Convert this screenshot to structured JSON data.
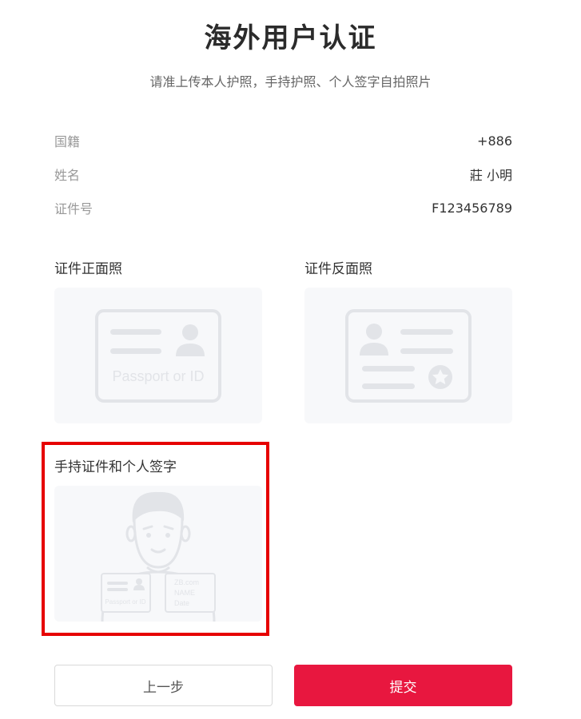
{
  "header": {
    "title": "海外用户认证",
    "subtitle": "请准上传本人护照，手持护照、个人签字自拍照片"
  },
  "info": [
    {
      "label": "国籍",
      "value": "+886"
    },
    {
      "label": "姓名",
      "value": "莊 小明"
    },
    {
      "label": "证件号",
      "value": "F123456789"
    }
  ],
  "uploads": {
    "front": {
      "label": "证件正面照",
      "illustration_text": "Passport or ID"
    },
    "back": {
      "label": "证件反面照"
    },
    "handheld": {
      "label": "手持证件和个人签字",
      "card_text": "Passport or ID",
      "sign_lines": [
        "ZB.com",
        "NAME",
        "Date"
      ]
    }
  },
  "actions": {
    "prev_label": "上一步",
    "submit_label": "提交"
  },
  "colors": {
    "accent": "#e8173f",
    "highlight": "#e60000",
    "upload_bg": "#f7f8fa",
    "illustration": "#e2e4e8"
  }
}
